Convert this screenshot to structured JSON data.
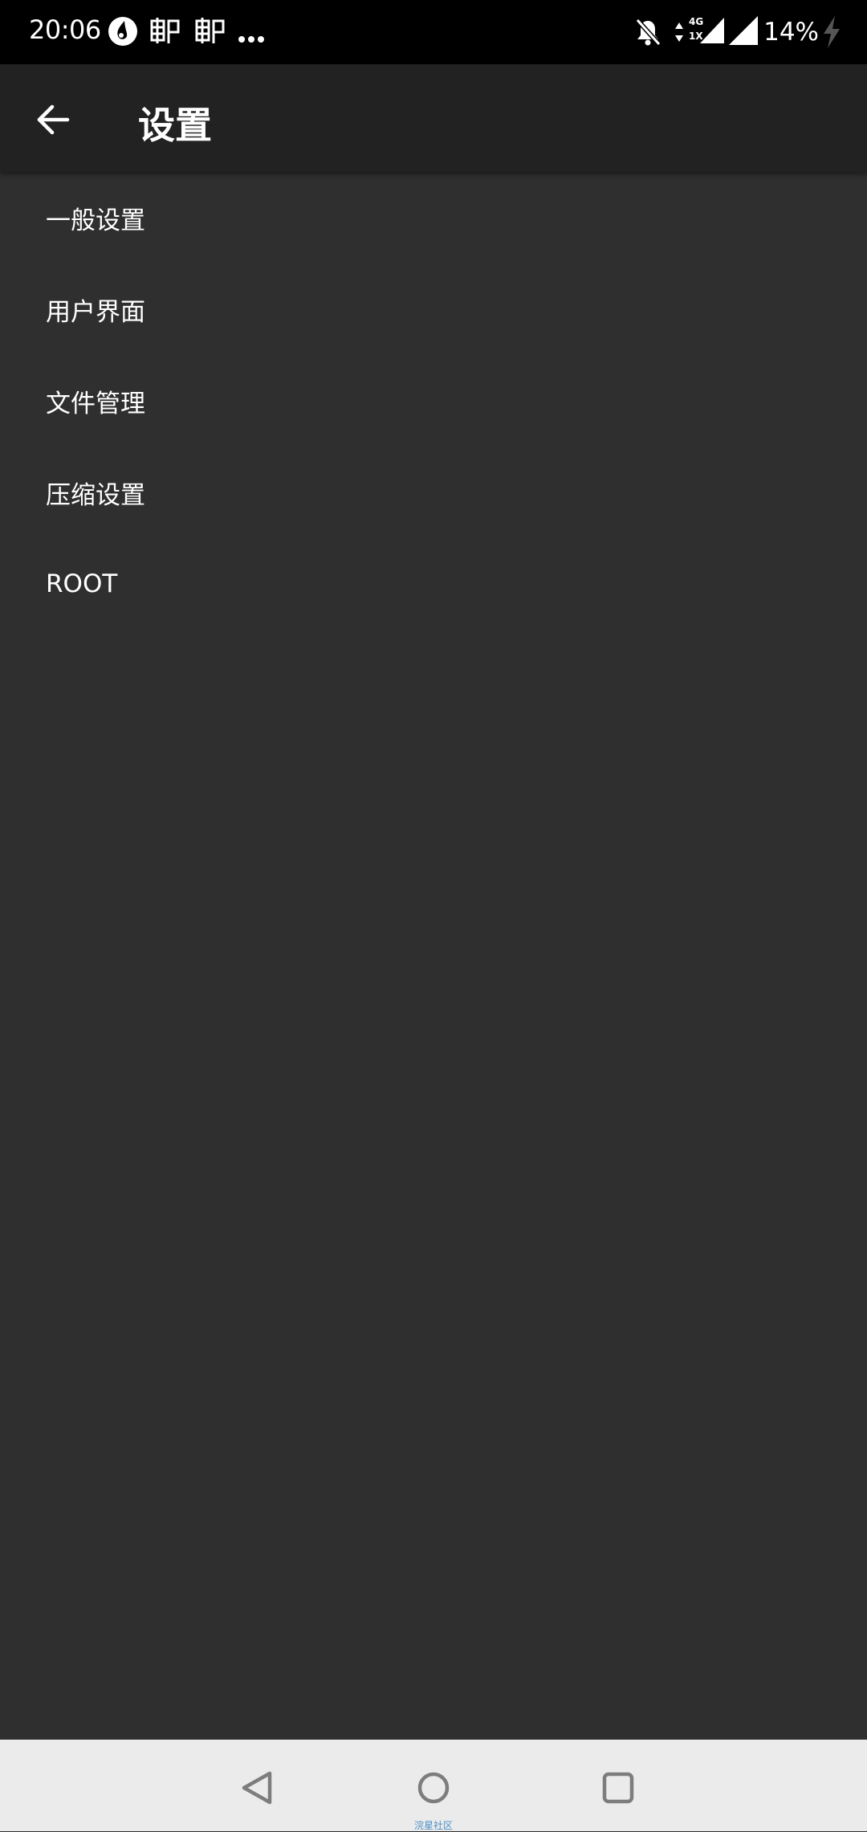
{
  "status_bar": {
    "time": "20:06",
    "battery": "14%",
    "network_type_top": "4G",
    "network_type_bottom": "1X",
    "icons": [
      "app-drop-icon",
      "mail-icon",
      "mail-icon",
      "more-dots-icon",
      "notifications-off-icon",
      "data-arrows-icon",
      "signal-icon",
      "signal-icon",
      "battery-charging-icon"
    ]
  },
  "app_bar": {
    "title": "设置",
    "back_icon": "arrow-back-icon"
  },
  "settings": {
    "items": [
      {
        "label": "一般设置"
      },
      {
        "label": "用户界面"
      },
      {
        "label": "文件管理"
      },
      {
        "label": "压缩设置"
      },
      {
        "label": "ROOT"
      }
    ]
  },
  "nav_bar": {
    "buttons": [
      "back-triangle-icon",
      "home-circle-icon",
      "recents-square-icon"
    ],
    "watermark": "浣星社区"
  },
  "colors": {
    "background": "#2f2f2f",
    "app_bar": "#222222",
    "status_bar": "#000000",
    "nav_bar": "#ebebeb",
    "text": "#ffffff"
  }
}
